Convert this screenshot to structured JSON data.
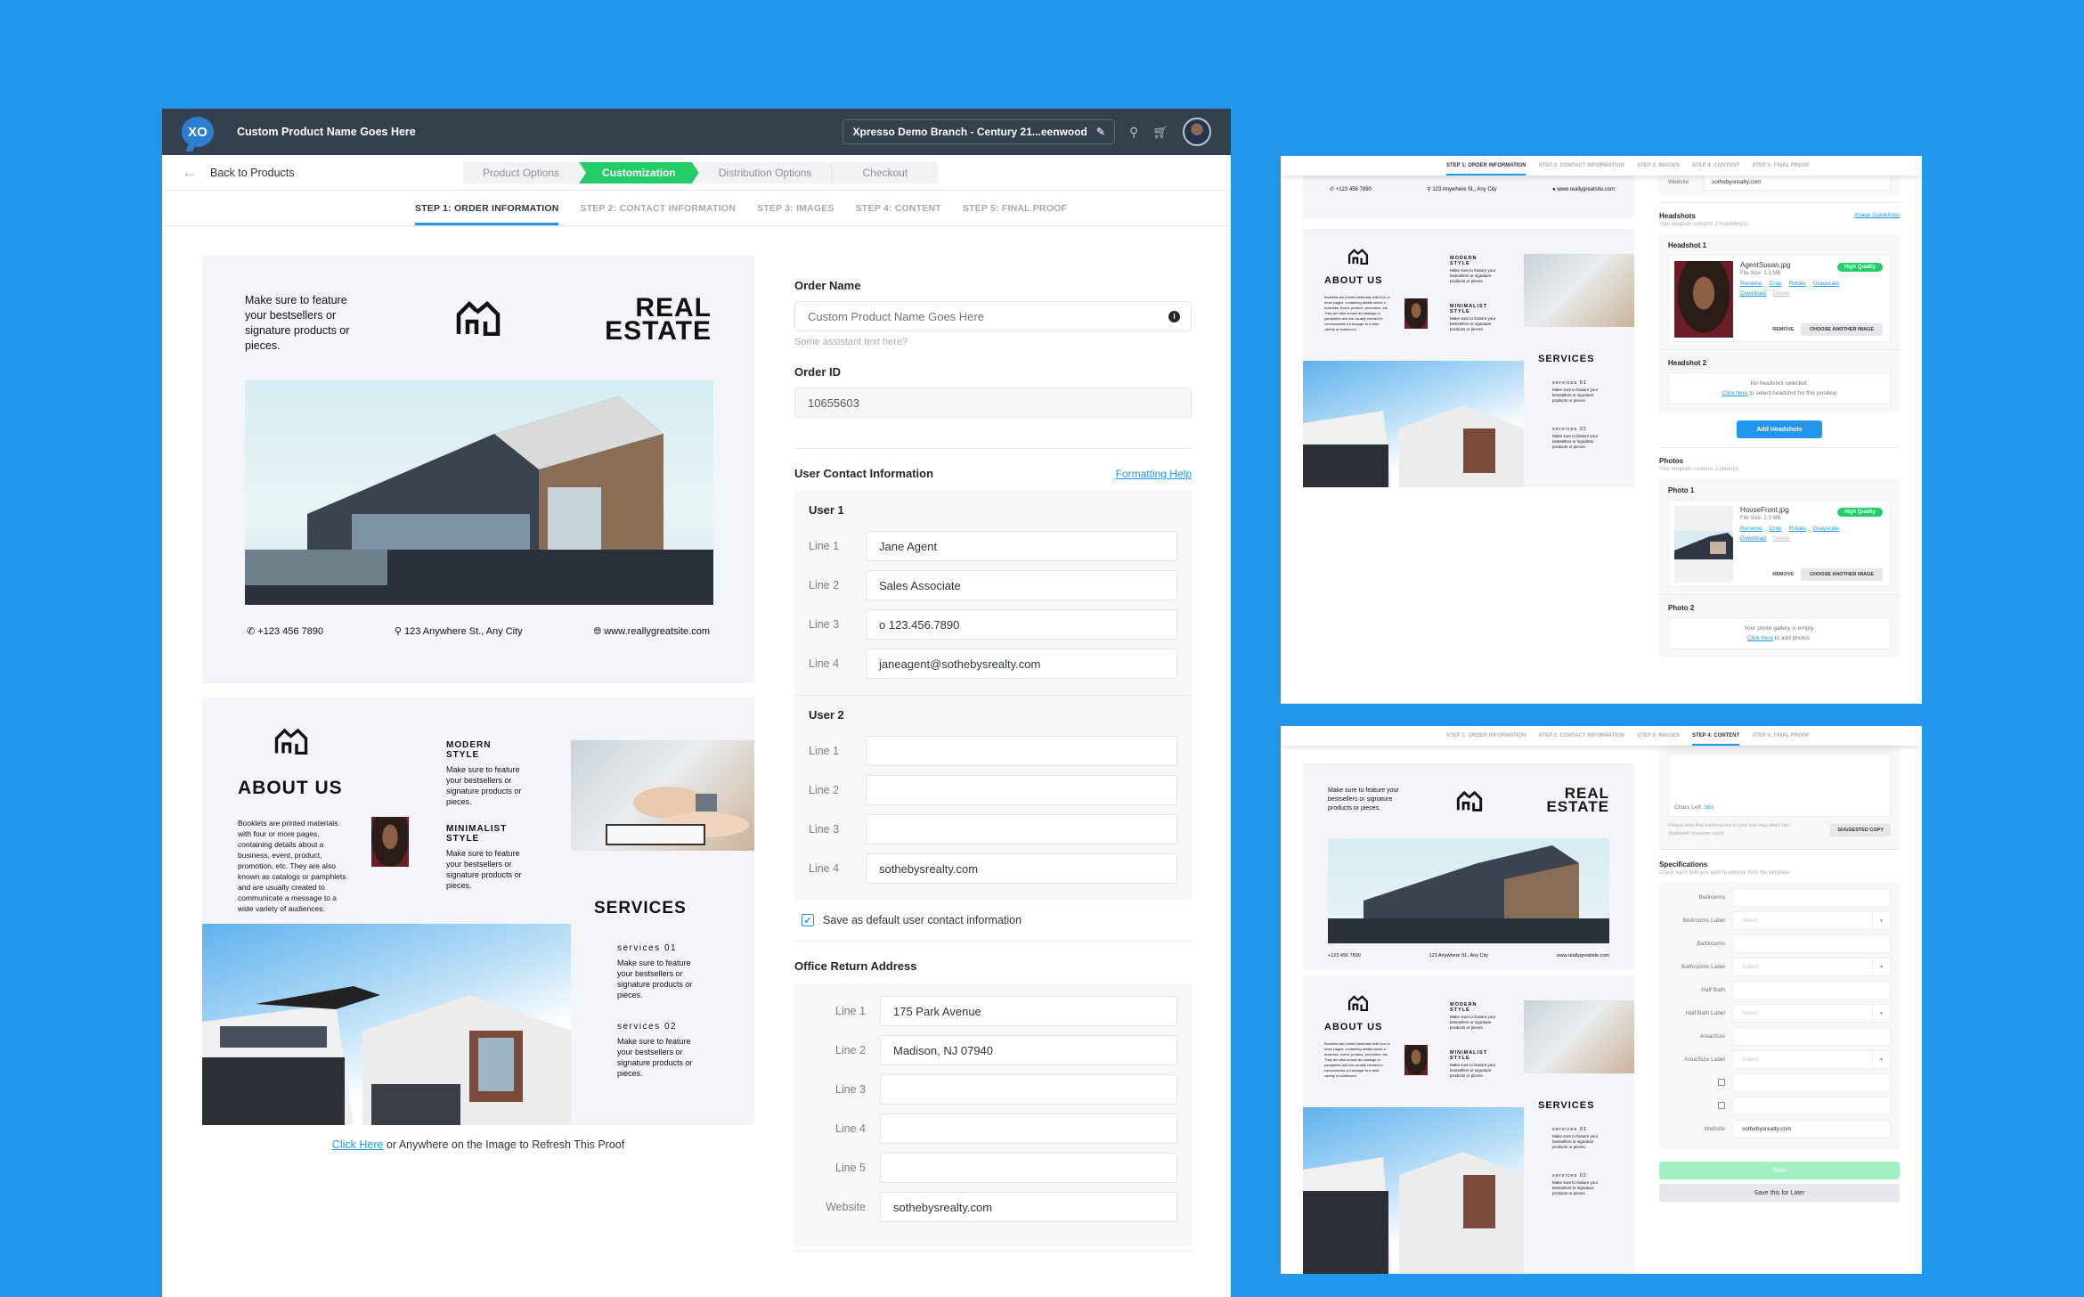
{
  "app": {
    "logo_text": "XO",
    "product_name": "Custom Product Name Goes Here",
    "branch_selector": "Xpresso Demo Branch  -  Century 21...eenwood",
    "icons": {
      "edit": "pencil-icon",
      "search": "search-icon",
      "cart": "cart-icon",
      "avatar": "user-avatar"
    }
  },
  "nav": {
    "back_label": "Back to Products",
    "crumbs": [
      "Product Options",
      "Customization",
      "Distribution Options",
      "Checkout"
    ],
    "active_crumb": "Customization",
    "steps": [
      "STEP 1: ORDER INFORMATION",
      "STEP 2: CONTACT INFORMATION",
      "STEP 3: IMAGES",
      "STEP 4: CONTENT",
      "STEP 5: FINAL PROOF"
    ],
    "active_step": "STEP 1: ORDER INFORMATION"
  },
  "brochure": {
    "tagline": "Make sure to feature your bestsellers or signature products or pieces.",
    "title_line1": "REAL",
    "title_line2": "ESTATE",
    "phone": "+123 456 7890",
    "address": "123 Anywhere St., Any City",
    "website": "www.reallygreatsite.com",
    "about_title": "ABOUT US",
    "about_text": "Booklets are printed materials with four or more pages, containing details about a business, event, product, promotion, etc. They are also known as catalogs or pamphlets and are usually created to communicate a message to a wide variety of audiences.",
    "modern_title1": "MODERN",
    "modern_title2": "STYLE",
    "modern_text": "Make sure to feature your bestsellers or signature products or pieces.",
    "minimal_title1": "MINIMALIST",
    "minimal_title2": "STYLE",
    "minimal_text": "Make sure to feature your bestsellers or signature products or pieces.",
    "services_title": "SERVICES",
    "service1_title": "services 01",
    "service1_text": "Make sure to feature your bestsellers or signature products or pieces.",
    "service2_title": "services 02",
    "service2_text": "Make sure to feature your bestsellers or signature products or pieces."
  },
  "refresh": {
    "link": "Click Here",
    "text": " or Anywhere on the Image to Refresh This Proof"
  },
  "form": {
    "order_name_label": "Order Name",
    "order_name_placeholder": "Custom Product Name Goes Here",
    "order_name_help": "Some assistant  text here?",
    "order_id_label": "Order ID",
    "order_id_value": "10655603",
    "contact_title": "User Contact Information",
    "formatting_help": "Formatting Help",
    "users": [
      {
        "title": "User 1",
        "lines": [
          {
            "label": "Line 1",
            "value": "Jane Agent"
          },
          {
            "label": "Line 2",
            "value": "Sales Associate"
          },
          {
            "label": "Line 3",
            "value": "o  123.456.7890"
          },
          {
            "label": "Line 4",
            "value": "janeagent@sothebysrealty.com"
          }
        ]
      },
      {
        "title": "User 2",
        "lines": [
          {
            "label": "Line 1",
            "value": ""
          },
          {
            "label": "Line 2",
            "value": ""
          },
          {
            "label": "Line 3",
            "value": ""
          },
          {
            "label": "Line 4",
            "value": "sothebysrealty.com"
          }
        ]
      }
    ],
    "save_default_label": "Save as default user contact information",
    "save_default_checked": true,
    "office_title": "Office Return Address",
    "office_lines": [
      {
        "label": "Line 1",
        "value": "175 Park Avenue"
      },
      {
        "label": "Line 2",
        "value": "Madison, NJ 07940"
      },
      {
        "label": "Line 3",
        "value": ""
      },
      {
        "label": "Line 4",
        "value": ""
      },
      {
        "label": "Line 5",
        "value": ""
      },
      {
        "label": "Website",
        "value": "sothebysrealty.com"
      }
    ]
  },
  "images_panel": {
    "website_label": "Website",
    "website_value": "sothebysrealty.com",
    "headshots_title": "Headshots",
    "headshots_sub": "Your template contains 2 headshot(s)",
    "image_guidelines": "Image Guidelines",
    "headshot1_title": "Headshot 1",
    "headshot1_file": "AgentSusan.jpg",
    "headshot1_size": "File Size: 1.3 MB",
    "quality_badge": "High Quality",
    "actions": [
      "Rename",
      "Crop",
      "Rotate",
      "Grayscale",
      "Download"
    ],
    "delete_label": "Delete",
    "remove_label": "REMOVE",
    "choose_label": "CHOOSE ANOTHER IMAGE",
    "headshot2_title": "Headshot 2",
    "headshot2_empty": "No headshot selected.",
    "headshot2_link": "Click here",
    "headshot2_rest": " to select headshot for this position",
    "add_headshots": "Add Headshots",
    "photos_title": "Photos",
    "photos_sub": "Your template contains 2 photo(s)",
    "photo1_title": "Photo 1",
    "photo1_file": "HouseFront.jpg",
    "photo1_size": "File Size: 1.3 MB",
    "photo2_title": "Photo 2",
    "photo2_empty": "Your photo gallery is empty.",
    "photo2_link": "Click here",
    "photo2_rest": " to add photos."
  },
  "content_panel": {
    "chars_left_label": "Chars Left:",
    "chars_left_value": "361",
    "note": "Please note that hard-returns in your text may affect the displayed character count",
    "suggested_copy": "SUGGESTED COPY",
    "spec_title": "Specifications",
    "spec_sub": "Check each field you wish to remove from the template",
    "spec_rows": [
      {
        "label": "Bedrooms",
        "type": "text",
        "value": ""
      },
      {
        "label": "Bedrooms Label",
        "type": "select",
        "value": "Select"
      },
      {
        "label": "Bathrooms",
        "type": "text",
        "value": ""
      },
      {
        "label": "Bathrooms Label",
        "type": "select",
        "value": "Select"
      },
      {
        "label": "Half Bath",
        "type": "text",
        "value": ""
      },
      {
        "label": "Half Bath Label",
        "type": "select",
        "value": "Select"
      },
      {
        "label": "Area/Size",
        "type": "text",
        "value": ""
      },
      {
        "label": "Area/Size Label",
        "type": "select",
        "value": "Select"
      },
      {
        "label": "",
        "type": "checkbox",
        "value": ""
      },
      {
        "label": "",
        "type": "checkbox",
        "value": ""
      },
      {
        "label": "Website",
        "type": "text",
        "value": "sothebysrealty.com"
      }
    ],
    "next_label": "Next",
    "save_later_label": "Save this for Later"
  },
  "colors": {
    "accent": "#2196ea",
    "success": "#22cc66",
    "topbar": "#35404f"
  }
}
